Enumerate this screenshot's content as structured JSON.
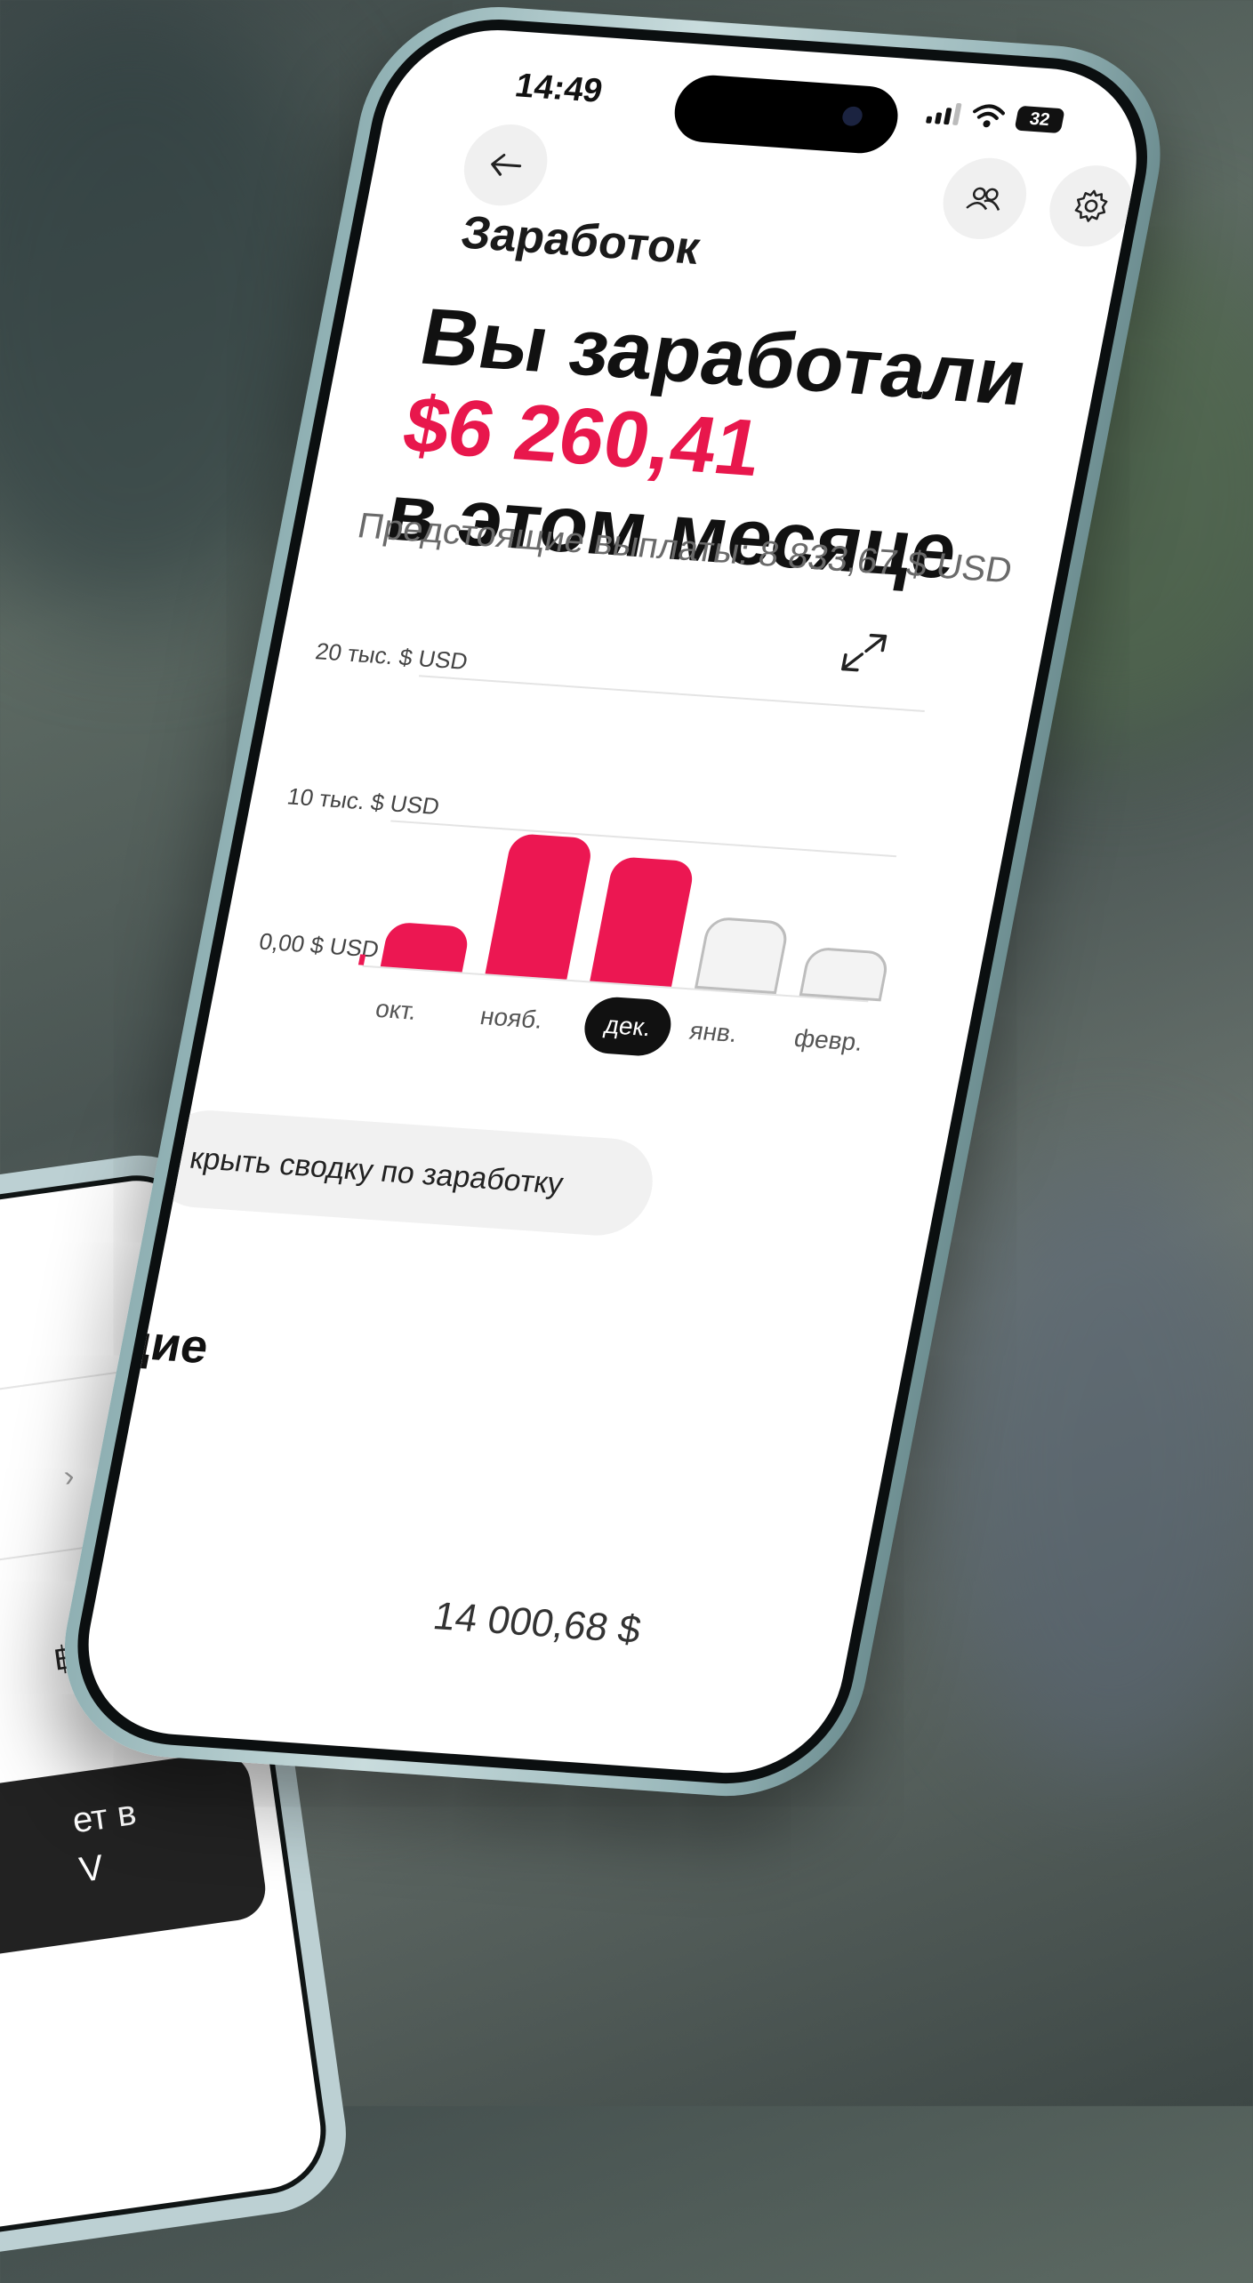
{
  "status_bar": {
    "time": "14:49",
    "battery": "32",
    "icons": [
      "signal-icon",
      "wifi-icon",
      "battery-icon"
    ]
  },
  "header": {
    "back_icon": "arrow-left-icon",
    "people_icon": "people-icon",
    "settings_icon": "gear-icon",
    "title": "Заработок"
  },
  "hero": {
    "line1": "Вы заработали",
    "amount": "$6 260,41",
    "line3": "в этом месяце",
    "accent_color": "#e8174c"
  },
  "upcoming_payouts": "Предстоящие выплаты: 8 833,67 $ USD",
  "chart_data": {
    "type": "bar",
    "y_tick_labels": [
      "20 тыс. $ USD",
      "10 тыс. $ USD",
      "0,00 $ USD"
    ],
    "ylim": [
      0,
      20000
    ],
    "categories": [
      "окт.",
      "нояб.",
      "дек.",
      "янв.",
      "февр."
    ],
    "series": [
      {
        "values": [
          180,
          3100,
          9700,
          8600,
          5000,
          3400
        ]
      }
    ],
    "paid_portion": [
      180,
      3100,
      9700,
      8600,
      0,
      0
    ],
    "selected_category": "дек.",
    "colors": {
      "paid": "#ec1752",
      "upcoming": "#f3f3f3",
      "outline": "#bdbdbd"
    },
    "grid": true
  },
  "summary_button": "крыть сводку по заработку",
  "section_title": "ящие",
  "bottom_amount": "14 000,68 $",
  "second_phone": {
    "baht": "฿",
    "dark_card_line1": "ет в",
    "dark_card_line2": "V"
  }
}
